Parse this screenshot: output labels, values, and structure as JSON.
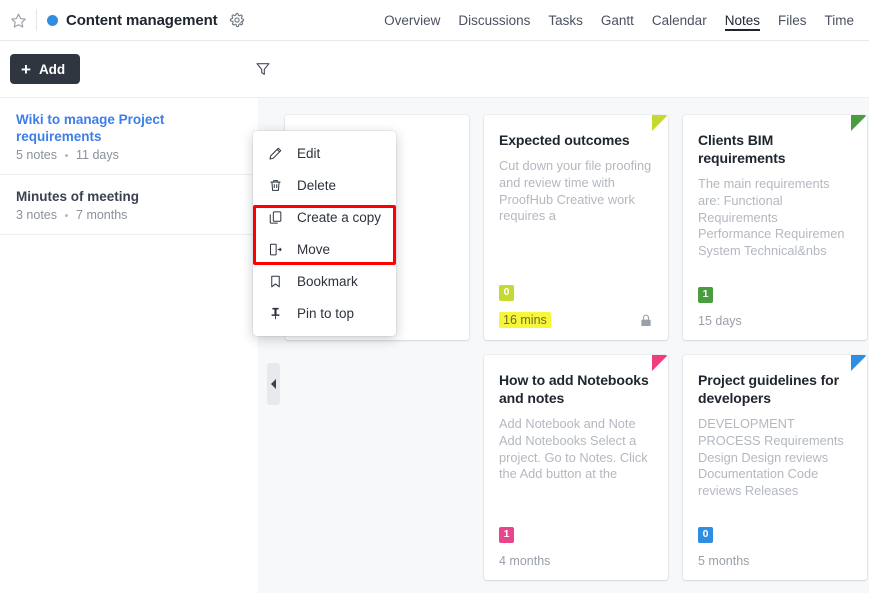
{
  "topbar": {
    "star_icon": "star-outline-icon",
    "project_dot_color": "#2f8de4",
    "project_title": "Content management",
    "gear_icon": "gear-icon",
    "nav": [
      {
        "label": "Overview",
        "active": false
      },
      {
        "label": "Discussions",
        "active": false
      },
      {
        "label": "Tasks",
        "active": false
      },
      {
        "label": "Gantt",
        "active": false
      },
      {
        "label": "Calendar",
        "active": false
      },
      {
        "label": "Notes",
        "active": true
      },
      {
        "label": "Files",
        "active": false
      },
      {
        "label": "Time",
        "active": false
      }
    ]
  },
  "actionbar": {
    "add_label": "Add",
    "add_plus": "+",
    "filter_icon": "filter-funnel-icon"
  },
  "sidebar": {
    "notebooks": [
      {
        "title": "Wiki to manage Project requirements",
        "notes": "5 notes",
        "age": "11 days",
        "selected": true
      },
      {
        "title": "Minutes of meeting",
        "notes": "3 notes",
        "age": "7 months",
        "selected": false
      }
    ]
  },
  "context_menu": {
    "items": [
      {
        "label": "Edit",
        "icon": "pencil-icon"
      },
      {
        "label": "Delete",
        "icon": "trash-icon"
      },
      {
        "label": "Create a copy",
        "icon": "copy-icon"
      },
      {
        "label": "Move",
        "icon": "move-out-icon"
      },
      {
        "label": "Bookmark",
        "icon": "bookmark-icon"
      },
      {
        "label": "Pin to top",
        "icon": "pin-icon"
      }
    ],
    "highlight_color": "#ff0000"
  },
  "content": {
    "collapse_handle_icon": "chevron-left-icon",
    "cards": [
      {
        "title": "",
        "excerpt": "",
        "count": "",
        "count_color": "",
        "fold_color": "",
        "age": "",
        "age_highlight": false,
        "locked": false,
        "blank": true
      },
      {
        "title": "Expected outcomes",
        "excerpt": "Cut down your file proofing and review time with ProofHub Creative work requires a",
        "count": "0",
        "count_color": "#c5d930",
        "fold_color": "#c5d930",
        "age": "16 mins",
        "age_highlight": true,
        "locked": true,
        "blank": false
      },
      {
        "title": "Clients BIM requirements",
        "excerpt": "The main requirements are: Functional Requirements Performance Requiremen System Technical&nbs",
        "count": "1",
        "count_color": "#4a9d3f",
        "fold_color": "#4a9d3f",
        "age": "15 days",
        "age_highlight": false,
        "locked": false,
        "blank": false
      },
      {
        "title": "How to add Notebooks and notes",
        "excerpt": "Add Notebook and Note Add Notebooks Select a project. Go to Notes. Click the Add button at the",
        "count": "1",
        "count_color": "#e8458c",
        "fold_color": "#ef3d7e",
        "age": "4 months",
        "age_highlight": false,
        "locked": false,
        "blank": false
      },
      {
        "title": "Project guidelines for developers",
        "excerpt": "DEVELOPMENT PROCESS  Requirements Design Design reviews Documentation Code reviews Releases",
        "count": "0",
        "count_color": "#2f8de4",
        "fold_color": "#2f8de4",
        "age": "5 months",
        "age_highlight": false,
        "locked": false,
        "blank": false
      }
    ]
  }
}
